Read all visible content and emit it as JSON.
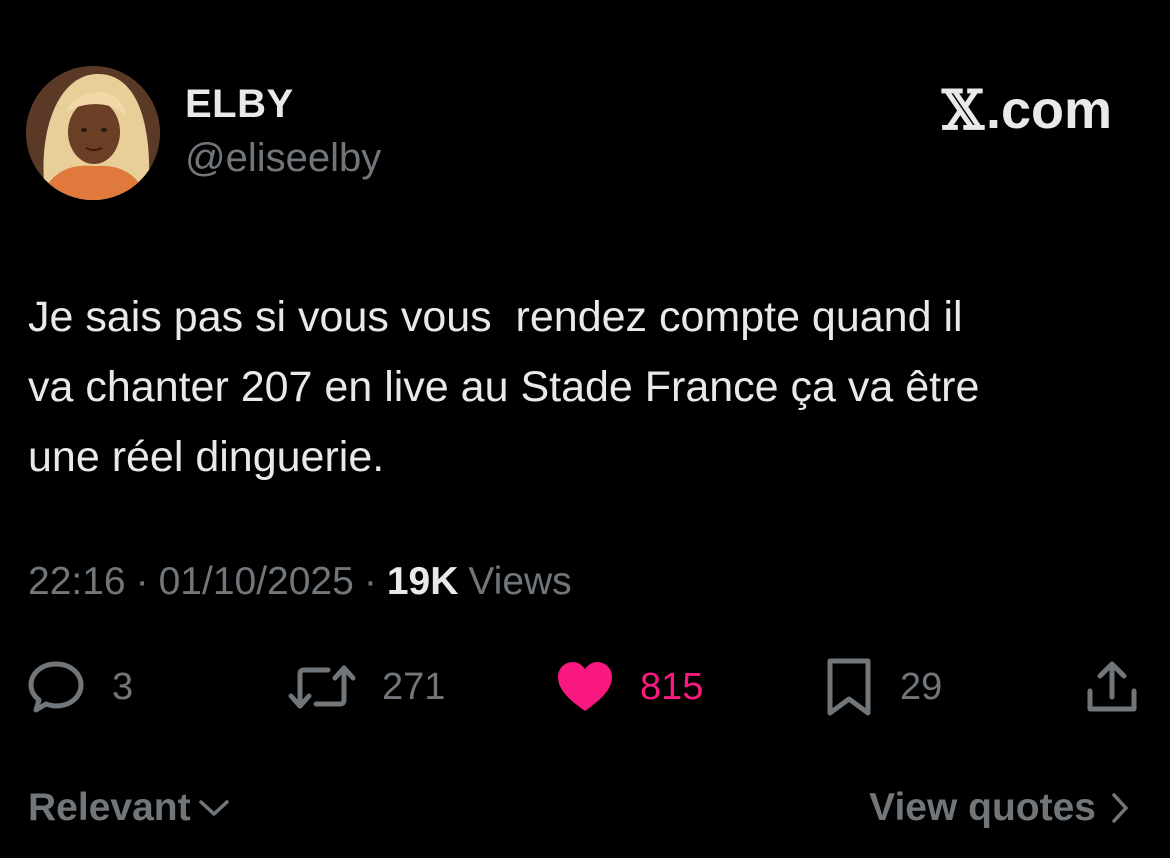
{
  "author": {
    "display_name": "ELBY",
    "handle": "@eliseelby"
  },
  "brand": {
    "glyph": "𝕏",
    "label": ".com"
  },
  "tweet": {
    "text": "Je sais pas si vous vous  rendez compte quand il\nva chanter 207 en live au Stade France ça va être\nune réel dinguerie."
  },
  "meta": {
    "time": "22:16",
    "date": "01/10/2025",
    "separator": "·",
    "views_count": "19K",
    "views_label": "Views"
  },
  "actions": {
    "replies": {
      "count": "3",
      "icon": "reply-icon"
    },
    "reposts": {
      "count": "271",
      "icon": "repost-icon"
    },
    "likes": {
      "count": "815",
      "icon": "heart-icon",
      "liked": true,
      "color": "#f91880"
    },
    "bookmarks": {
      "count": "29",
      "icon": "bookmark-icon"
    },
    "share": {
      "icon": "share-icon"
    }
  },
  "footer": {
    "sort_label": "Relevant",
    "quotes_label": "View quotes"
  },
  "colors": {
    "background": "#000000",
    "primary_text": "#e7e9ea",
    "secondary_text": "#71767b",
    "like": "#f91880"
  }
}
